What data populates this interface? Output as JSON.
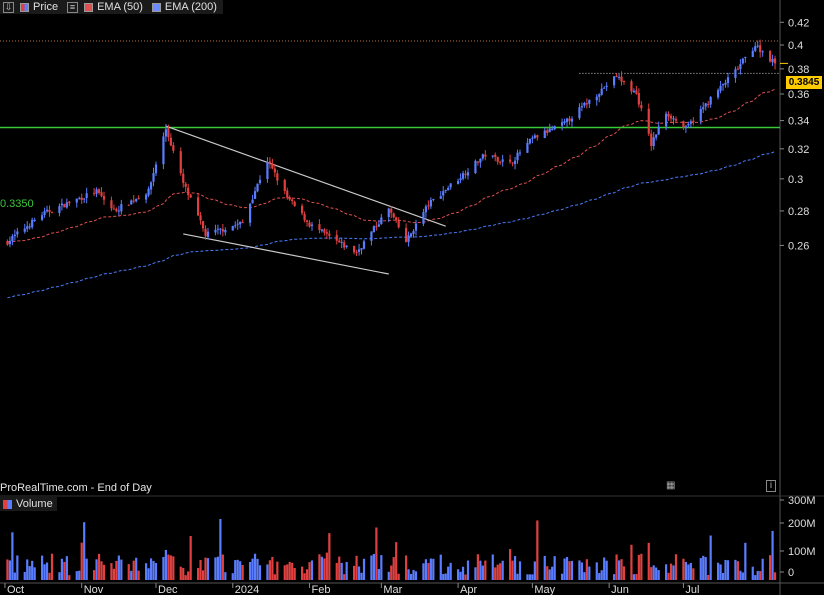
{
  "legend": {
    "price_label": "Price",
    "ema50_label": "EMA (50)",
    "ema200_label": "EMA (200)",
    "volume_label": "Volume"
  },
  "source_text": "ProRealTime.com - End of Day",
  "resistance_label": "0.3350",
  "last_price_label": "0.3845",
  "colors": {
    "background": "#000000",
    "up": "#5a7dff",
    "down": "#e04040",
    "ema50": "#e05050",
    "ema200": "#4a7dff",
    "resistance": "#38c838",
    "trendline": "#c8c8c8",
    "price_tag": "#ffcc00"
  },
  "chart_data": {
    "type": "candlestick",
    "x_axis": {
      "tick_labels": [
        "Oct",
        "Nov",
        "Dec",
        "2024",
        "Feb",
        "Mar",
        "Apr",
        "May",
        "Jun",
        "Jul"
      ]
    },
    "y_axis": {
      "scale": "log",
      "tick_labels": [
        "0.42",
        "0.4",
        "0.38",
        "0.36",
        "0.34",
        "0.32",
        "0.3",
        "0.28",
        "0.26"
      ],
      "range": [
        0.25,
        0.42
      ]
    },
    "volume_axis": {
      "tick_labels": [
        "300M",
        "200M",
        "100M",
        "0"
      ]
    },
    "anchors": [
      {
        "date": "2023-10-02",
        "close": 0.262
      },
      {
        "date": "2023-10-16",
        "close": 0.278
      },
      {
        "date": "2023-10-30",
        "close": 0.287
      },
      {
        "date": "2023-11-07",
        "close": 0.292
      },
      {
        "date": "2023-11-14",
        "close": 0.28
      },
      {
        "date": "2023-11-28",
        "close": 0.292
      },
      {
        "date": "2023-12-05",
        "close": 0.334
      },
      {
        "date": "2023-12-12",
        "close": 0.297
      },
      {
        "date": "2023-12-21",
        "close": 0.266
      },
      {
        "date": "2024-01-05",
        "close": 0.273
      },
      {
        "date": "2024-01-15",
        "close": 0.312
      },
      {
        "date": "2024-01-23",
        "close": 0.288
      },
      {
        "date": "2024-02-01",
        "close": 0.272
      },
      {
        "date": "2024-02-12",
        "close": 0.262
      },
      {
        "date": "2024-02-20",
        "close": 0.256
      },
      {
        "date": "2024-03-04",
        "close": 0.281
      },
      {
        "date": "2024-03-11",
        "close": 0.262
      },
      {
        "date": "2024-03-20",
        "close": 0.284
      },
      {
        "date": "2024-04-01",
        "close": 0.3
      },
      {
        "date": "2024-04-12",
        "close": 0.316
      },
      {
        "date": "2024-04-22",
        "close": 0.31
      },
      {
        "date": "2024-05-01",
        "close": 0.327
      },
      {
        "date": "2024-05-14",
        "close": 0.338
      },
      {
        "date": "2024-05-27",
        "close": 0.36
      },
      {
        "date": "2024-06-04",
        "close": 0.374
      },
      {
        "date": "2024-06-12",
        "close": 0.36
      },
      {
        "date": "2024-06-18",
        "close": 0.323
      },
      {
        "date": "2024-06-24",
        "close": 0.346
      },
      {
        "date": "2024-07-02",
        "close": 0.334
      },
      {
        "date": "2024-07-11",
        "close": 0.354
      },
      {
        "date": "2024-07-22",
        "close": 0.378
      },
      {
        "date": "2024-07-30",
        "close": 0.4
      },
      {
        "date": "2024-08-07",
        "close": 0.3845
      }
    ],
    "resistance_level": 0.335,
    "last_price": 0.3845,
    "high_marker": 0.4,
    "support_marker": 0.378,
    "annotations": [
      "0.3350",
      "0.3845"
    ]
  }
}
